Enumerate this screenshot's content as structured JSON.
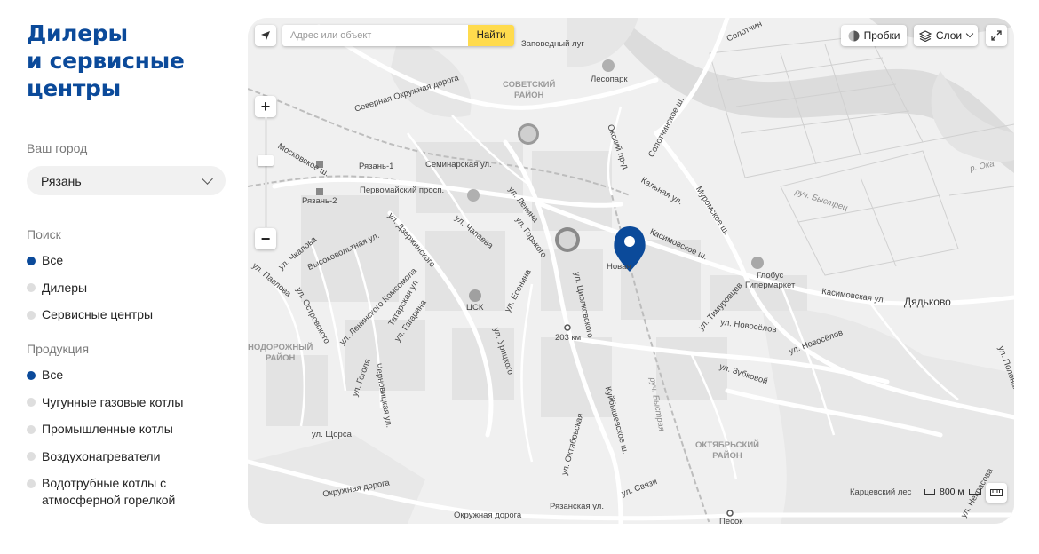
{
  "sidebar": {
    "title_lines": [
      "Дилеры",
      "и сервисные",
      "центры"
    ],
    "city_label": "Ваш город",
    "city_value": "Рязань",
    "search_label": "Поиск",
    "search_options": [
      {
        "label": "Все",
        "active": true
      },
      {
        "label": "Дилеры",
        "active": false
      },
      {
        "label": "Сервисные центры",
        "active": false
      }
    ],
    "products_label": "Продукция",
    "product_options": [
      {
        "label": "Все",
        "active": true
      },
      {
        "label": "Чугунные газовые котлы",
        "active": false
      },
      {
        "label": "Промышленные котлы",
        "active": false
      },
      {
        "label": "Воздухонагреватели",
        "active": false
      },
      {
        "label": "Водотрубные котлы с атмосферной горелкой",
        "active": false
      }
    ]
  },
  "map": {
    "search_placeholder": "Адрес или объект",
    "search_button": "Найти",
    "traffic_button": "Пробки",
    "layers_button": "Слои",
    "scale_label": "800 м",
    "accent_color": "#0b4a9a",
    "labels": {
      "sovetsky": [
        "СОВЕТСКИЙ",
        "РАЙОН"
      ],
      "oktyabrsky": [
        "ОКТЯБРЬСКИЙ",
        "РАЙОН"
      ],
      "zheleznodorozhny": [
        "НОДОРОЖНЫЙ",
        "РАЙОН"
      ],
      "dyadkovo": "Дядьково",
      "zapovedny": "Заповедный луг",
      "lesopark": "Лесопарк",
      "ryazan1": "Рязань-1",
      "ryazan2": "Рязань-2",
      "tsk": "ЦСК",
      "globus": [
        "Глобус",
        "Гипермаркет"
      ],
      "karcevsky": "Карцевский лес",
      "novaya": "Новая",
      "km203": "203 км",
      "pesok": "Песок",
      "river_oka": "р. Ока",
      "ruch_bystrets": "руч. Быстрец",
      "ruch_bystraya": "руч. Быстрая",
      "severnaya_okruzhnaya": "Северная Окружная дорога",
      "okruzhnaya": "Окружная дорога",
      "okruzhnaya_doroga_2": "Окружная дорога",
      "solotchinskoe": "Солотчинское ш.",
      "solotchin_top": "Солотчин",
      "muromskoe": "Муромское ш.",
      "kasimovskoe": "Касимовское ш.",
      "moskovskoe": "Московское ш.",
      "pervomaysky": "Первомайский просп.",
      "seminarskaya": "Семинарская ул.",
      "lenina": "ул. Ленина",
      "esenina": "ул. Есенина",
      "tsiolkovskogo": "ул. Циолковского",
      "dzerzhinskogo": "ул. Дзержинского",
      "zubkovoy": "ул. Зубковой",
      "kuybyshevskoe": "Куйбышевское ш.",
      "vysokovoltnaya": "Высоковольтная ул.",
      "chkalova": "ул. Чкалова",
      "ostrovskogo": "ул. Островского",
      "leninskogo_komsomola": "ул. Ленинского Комсомола",
      "tatarskaya": "Татарская ул.",
      "gagarina": "ул. Гагарина",
      "chapaeva": "ул. Чапаева",
      "gorkogo": "ул. Горького",
      "timuroovtsev": "ул. Тимуровцев",
      "novosyolov": "ул. Новосёлов",
      "novosyolov2": "ул. Новосёлов",
      "shcorsa": "ул. Щорса",
      "gogolya": "ул. Гоголя",
      "svyazi": "ул. Связи",
      "ryazanskaya": "Рязанская ул.",
      "kalnaya": "Кальная ул.",
      "okskiy": "Окский пр-д",
      "chernovitskaya": "Черновицкая ул.",
      "kasimovskaya": "Касимовская ул.",
      "uritskogo": "ул. Урицкого",
      "oktyabrskaya": "ул. Октябрьская",
      "pavlova": "ул. Павлова",
      "polevaya": "ул. Полевая",
      "nekrasova": "ул. Некрасова"
    }
  }
}
